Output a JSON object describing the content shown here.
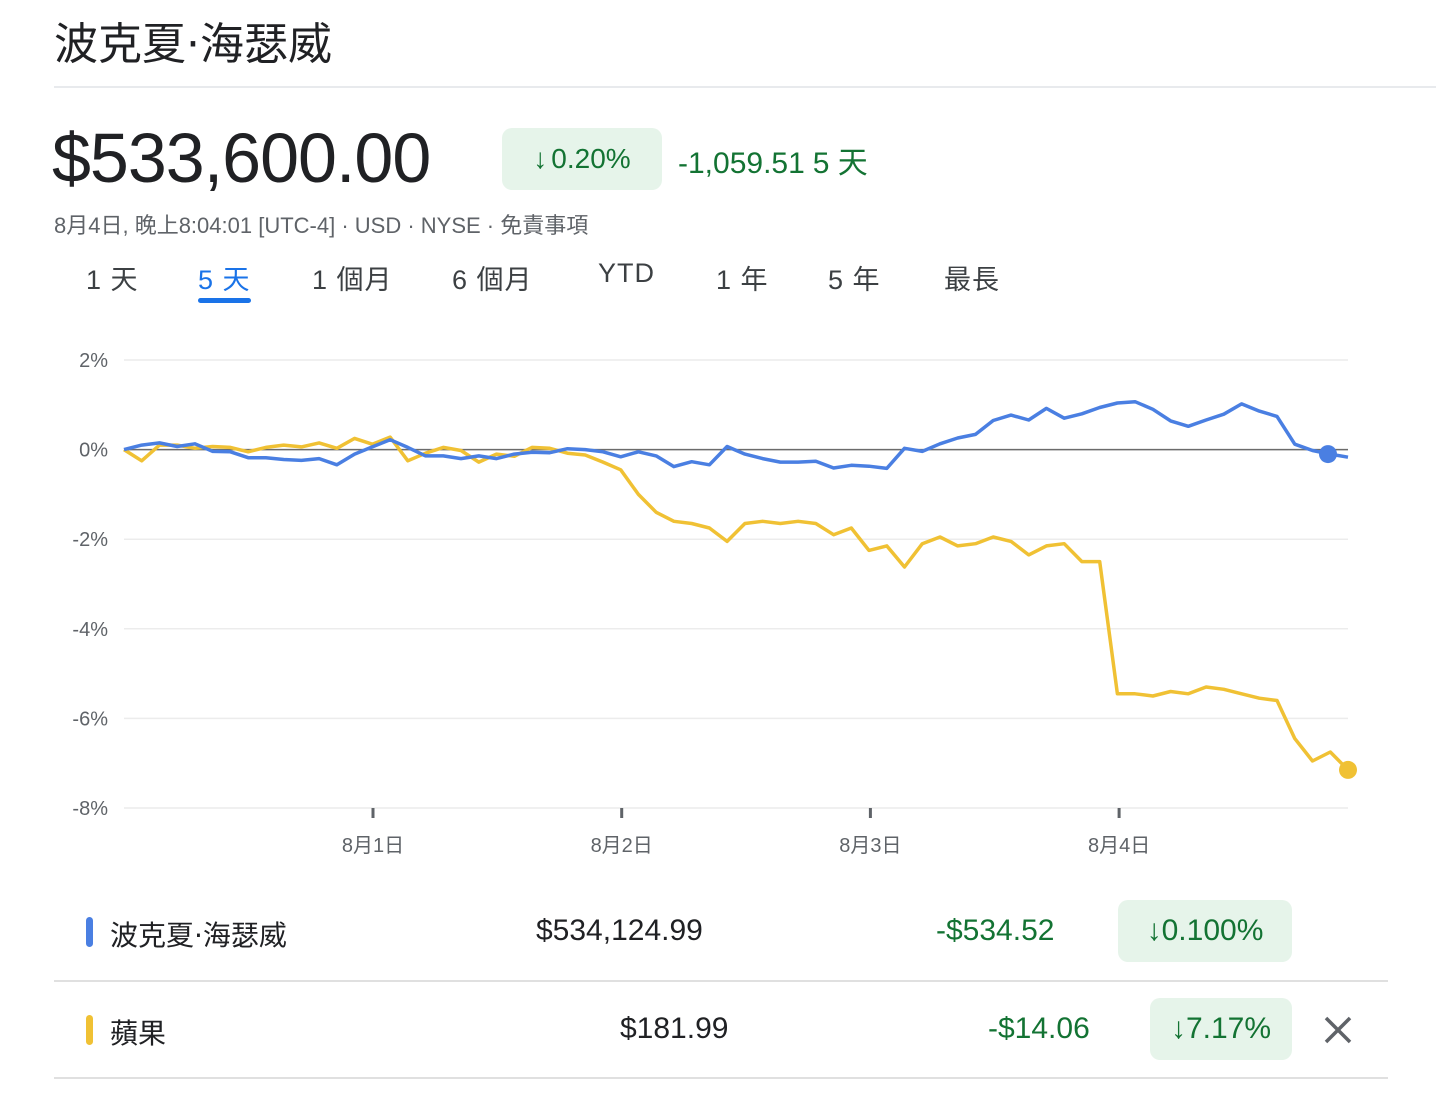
{
  "header": {
    "title": "波克夏·海瑟威"
  },
  "quote": {
    "price": "$533,600.00",
    "pct_arrow": "↓",
    "pct": "0.20%",
    "change": "-1,059.51",
    "period": "5 天",
    "meta_prefix": "8月4日, 晚上8:04:01 [UTC-4] · USD · NYSE · ",
    "disclaimer": "免責事項"
  },
  "tabs": [
    {
      "label": "1 天",
      "active": false
    },
    {
      "label": "5 天",
      "active": true
    },
    {
      "label": "1 個月",
      "active": false
    },
    {
      "label": "6 個月",
      "active": false
    },
    {
      "label": "YTD",
      "active": false
    },
    {
      "label": "1 年",
      "active": false
    },
    {
      "label": "5 年",
      "active": false
    },
    {
      "label": "最長",
      "active": false
    }
  ],
  "chart_data": {
    "type": "line",
    "y_ticks": [
      "2%",
      "0%",
      "-2%",
      "-4%",
      "-6%",
      "-8%"
    ],
    "ylim": [
      -8,
      2
    ],
    "x_ticks": [
      "8月1日",
      "8月2日",
      "8月3日",
      "8月4日"
    ],
    "baseline": 0,
    "series": [
      {
        "name": "波克夏·海瑟威",
        "color": "#4a7fe2",
        "values": [
          0,
          0.1,
          0.15,
          0.07,
          0.13,
          -0.04,
          -0.05,
          -0.18,
          -0.18,
          -0.22,
          -0.24,
          -0.2,
          -0.34,
          -0.1,
          0.06,
          0.22,
          0.05,
          -0.14,
          -0.14,
          -0.2,
          -0.14,
          -0.2,
          -0.1,
          -0.06,
          -0.07,
          0.02,
          0,
          -0.05,
          -0.16,
          -0.05,
          -0.14,
          -0.38,
          -0.27,
          -0.34,
          0.07,
          -0.1,
          -0.2,
          -0.28,
          -0.28,
          -0.26,
          -0.41,
          -0.35,
          -0.37,
          -0.42,
          0.03,
          -0.04,
          0.13,
          0.26,
          0.34,
          0.65,
          0.77,
          0.66,
          0.92,
          0.7,
          0.8,
          0.94,
          1.04,
          1.07,
          0.9,
          0.64,
          0.52,
          0.66,
          0.79,
          1.02,
          0.86,
          0.74,
          0.12,
          -0.02,
          -0.1,
          -0.17
        ],
        "end_value": -0.1
      },
      {
        "name": "蘋果",
        "color": "#f0c134",
        "values": [
          0,
          -0.25,
          0.1,
          0.1,
          0.03,
          0.07,
          0.05,
          -0.05,
          0.05,
          0.1,
          0.06,
          0.15,
          0.03,
          0.25,
          0.12,
          0.28,
          -0.25,
          -0.08,
          0.05,
          -0.02,
          -0.28,
          -0.1,
          -0.15,
          0.05,
          0.03,
          -0.08,
          -0.12,
          -0.28,
          -0.45,
          -1.0,
          -1.4,
          -1.6,
          -1.65,
          -1.75,
          -2.05,
          -1.65,
          -1.6,
          -1.65,
          -1.6,
          -1.65,
          -1.9,
          -1.75,
          -2.25,
          -2.15,
          -2.62,
          -2.1,
          -1.95,
          -2.15,
          -2.1,
          -1.95,
          -2.05,
          -2.35,
          -2.15,
          -2.1,
          -2.5,
          -2.5,
          -5.45,
          -5.45,
          -5.5,
          -5.4,
          -5.45,
          -5.3,
          -5.35,
          -5.45,
          -5.55,
          -5.6,
          -6.45,
          -6.95,
          -6.75,
          -7.15
        ],
        "end_value": -7.15
      }
    ]
  },
  "comparison": [
    {
      "name": "波克夏·海瑟威",
      "color": "#4a7fe2",
      "price": "$534,124.99",
      "change": "-$534.52",
      "pct_arrow": "↓",
      "pct": "0.100%",
      "removable": false
    },
    {
      "name": "蘋果",
      "color": "#f0c134",
      "price": "$181.99",
      "change": "-$14.06",
      "pct_arrow": "↓",
      "pct": "7.17%",
      "removable": true
    }
  ],
  "icons": {
    "close": "close-icon",
    "down_arrow": "arrow-down-icon"
  }
}
